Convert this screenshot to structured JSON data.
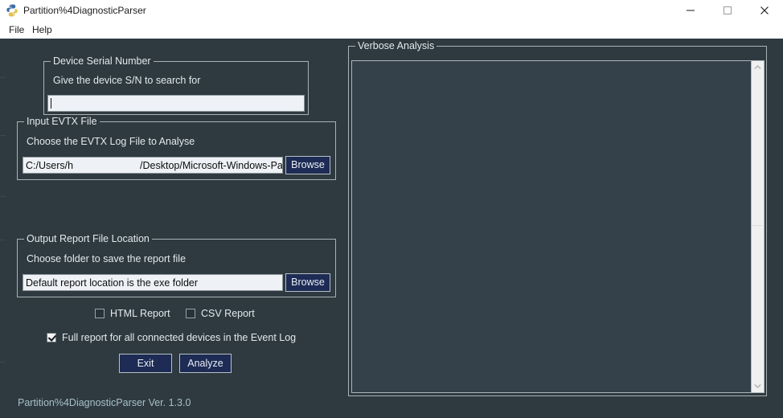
{
  "window": {
    "title": "Partition%4DiagnosticParser",
    "icon": "python-logo-icon",
    "controls": {
      "minimize": "minimize-icon",
      "maximize": "maximize-icon",
      "close": "close-icon"
    }
  },
  "menubar": {
    "items": [
      {
        "label": "File"
      },
      {
        "label": "Help"
      }
    ]
  },
  "serial_group": {
    "title": "Device Serial Number",
    "label": "Give the device S/N to search for",
    "input_value": "",
    "input_placeholder": ""
  },
  "input_evtx_group": {
    "title": "Input EVTX File",
    "label": "Choose the EVTX Log File to Analyse",
    "path_prefix": "C:/Users/h",
    "path_suffix": "/Desktop/Microsoft-Windows-Partitio",
    "browse_label": "Browse"
  },
  "output_group": {
    "title": "Output Report File Location",
    "label": "Choose folder to save the report file",
    "path_value": "Default report location is the exe folder",
    "browse_label": "Browse"
  },
  "options": {
    "html_report": {
      "label": "HTML Report",
      "checked": false
    },
    "csv_report": {
      "label": "CSV Report",
      "checked": false
    },
    "full_report": {
      "label": "Full report for all connected devices in the Event Log",
      "checked": true
    }
  },
  "actions": {
    "exit_label": "Exit",
    "analyze_label": "Analyze"
  },
  "verbose": {
    "title": "Verbose Analysis",
    "content": "",
    "scroll_up_icon": "chevron-up-icon",
    "scroll_down_icon": "chevron-down-icon"
  },
  "status": {
    "version_text": "Partition%4DiagnosticParser Ver. 1.3.0"
  },
  "colors": {
    "background": "#2e3a40",
    "panel": "#34414a",
    "button_fill": "#1d2b55",
    "text": "#e3e9ec",
    "status_text": "#a8c0c8",
    "field_bg": "#eef1f5",
    "border": "#a9b2b6"
  }
}
